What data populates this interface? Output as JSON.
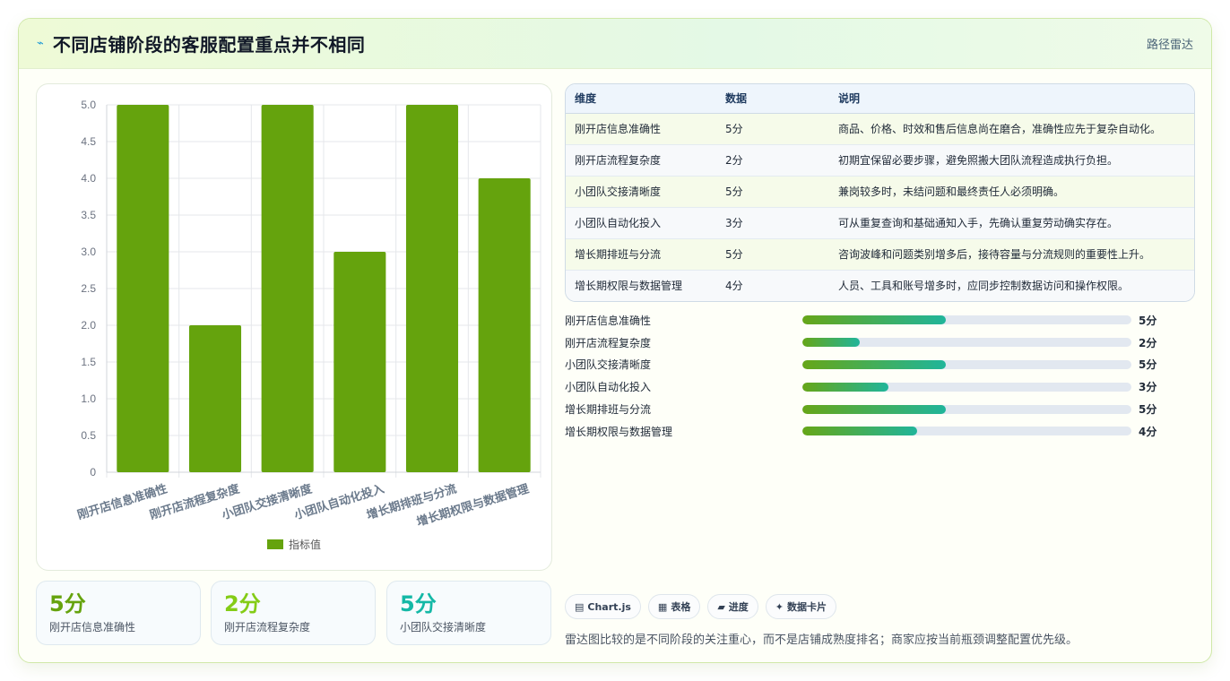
{
  "header": {
    "icon": "sparkline-icon",
    "title": "不同店铺阶段的客服配置重点并不相同",
    "link": "路径雷达"
  },
  "chart_data": {
    "type": "bar",
    "categories": [
      "刚开店信息准确性",
      "刚开店流程复杂度",
      "小团队交接清晰度",
      "小团队自动化投入",
      "增长期排班与分流",
      "增长期权限与数据管理"
    ],
    "series": [
      {
        "name": "指标值",
        "values": [
          5,
          2,
          5,
          3,
          5,
          4
        ],
        "color": "#65a30d"
      }
    ],
    "y_ticks": [
      "0",
      "0.5",
      "1.0",
      "1.5",
      "2.0",
      "2.5",
      "3.0",
      "3.5",
      "4.0",
      "4.5",
      "5.0"
    ],
    "ylim": [
      0,
      5
    ],
    "grid": true,
    "legend": "bottom"
  },
  "table": {
    "headers": [
      "维度",
      "数据",
      "说明"
    ],
    "rows": [
      [
        "刚开店信息准确性",
        "5分",
        "商品、价格、时效和售后信息尚在磨合，准确性应先于复杂自动化。"
      ],
      [
        "刚开店流程复杂度",
        "2分",
        "初期宜保留必要步骤，避免照搬大团队流程造成执行负担。"
      ],
      [
        "小团队交接清晰度",
        "5分",
        "兼岗较多时，未结问题和最终责任人必须明确。"
      ],
      [
        "小团队自动化投入",
        "3分",
        "可从重复查询和基础通知入手，先确认重复劳动确实存在。"
      ],
      [
        "增长期排班与分流",
        "5分",
        "咨询波峰和问题类别增多后，接待容量与分流规则的重要性上升。"
      ],
      [
        "增长期权限与数据管理",
        "4分",
        "人员、工具和账号增多时，应同步控制数据访问和操作权限。"
      ]
    ]
  },
  "progress": {
    "max": 5,
    "items": [
      {
        "label": "刚开店信息准确性",
        "value": 5,
        "text": "5分"
      },
      {
        "label": "刚开店流程复杂度",
        "value": 2,
        "text": "2分"
      },
      {
        "label": "小团队交接清晰度",
        "value": 5,
        "text": "5分"
      },
      {
        "label": "小团队自动化投入",
        "value": 3,
        "text": "3分"
      },
      {
        "label": "增长期排班与分流",
        "value": 5,
        "text": "5分"
      },
      {
        "label": "增长期权限与数据管理",
        "value": 4,
        "text": "4分"
      }
    ]
  },
  "kpis": [
    {
      "value": "5分",
      "label": "刚开店信息准确性",
      "color": "#65a30d"
    },
    {
      "value": "2分",
      "label": "刚开店流程复杂度",
      "color": "#84cc16"
    },
    {
      "value": "5分",
      "label": "小团队交接清晰度",
      "color": "#14b8a6"
    }
  ],
  "chips": [
    {
      "icon": "chart-icon",
      "glyph": "▤",
      "label": "Chart.js"
    },
    {
      "icon": "table-icon",
      "glyph": "▦",
      "label": "表格"
    },
    {
      "icon": "progress-icon",
      "glyph": "▰",
      "label": "进度"
    },
    {
      "icon": "sparkle-icon",
      "glyph": "✦",
      "label": "数据卡片"
    }
  ],
  "note": "雷达图比较的是不同阶段的关注重心，而不是店铺成熟度排名；商家应按当前瓶颈调整配置优先级。"
}
